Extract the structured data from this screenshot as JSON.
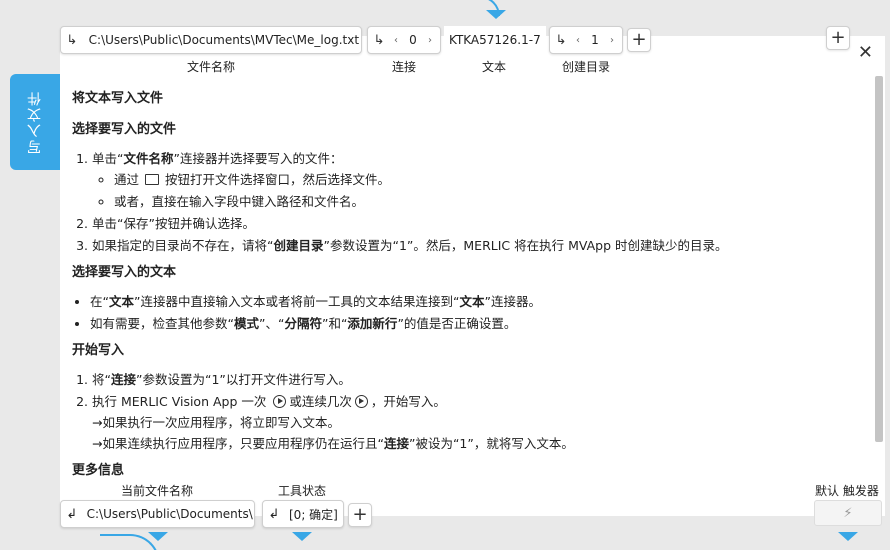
{
  "tool": {
    "side_tab_label": "写入文件"
  },
  "inputs": {
    "file_name": {
      "value": "C:\\Users\\Public\\Documents\\MVTec\\Me_log.txt",
      "label": "文件名称"
    },
    "connect": {
      "value": "0",
      "label": "连接"
    },
    "text": {
      "value": "KTKA57126.1-7",
      "label": "文本"
    },
    "create_dir": {
      "value": "1",
      "label": "创建目录"
    }
  },
  "help": {
    "title": "将文本写入文件",
    "sec1_title": "选择要写入的文件",
    "sec1_item1_pre": "单击“",
    "sec1_item1_bold": "文件名称",
    "sec1_item1_post": "”连接器并选择要写入的文件：",
    "sec1_sub1_pre": "通过",
    "sec1_sub1_post": "按钮打开文件选择窗口，然后选择文件。",
    "sec1_sub2": "或者，直接在输入字段中键入路径和文件名。",
    "sec1_item2": "单击“保存”按钮并确认选择。",
    "sec1_item3_pre": "如果指定的目录尚不存在，请将“",
    "sec1_item3_bold": "创建目录",
    "sec1_item3_post": "”参数设置为“1”。然后，MERLIC 将在执行 MVApp 时创建缺少的目录。",
    "sec2_title": "选择要写入的文本",
    "sec2_item1_pre": "在“",
    "sec2_item1_bold1": "文本",
    "sec2_item1_mid": "”连接器中直接输入文本或者将前一工具的文本结果连接到“",
    "sec2_item1_bold2": "文本",
    "sec2_item1_post": "”连接器。",
    "sec2_item2_pre": "如有需要，检查其他参数“",
    "sec2_item2_b1": "模式",
    "sec2_item2_m1": "”、“",
    "sec2_item2_b2": "分隔符",
    "sec2_item2_m2": "”和“",
    "sec2_item2_b3": "添加新行",
    "sec2_item2_post": "”的值是否正确设置。",
    "sec3_title": "开始写入",
    "sec3_item1_pre": "将“",
    "sec3_item1_bold": "连接",
    "sec3_item1_post": "”参数设置为“1”以打开文件进行写入。",
    "sec3_item2_pre": "执行 MERLIC Vision App 一次",
    "sec3_item2_mid": "或连续几次",
    "sec3_item2_post": "，开始写入。",
    "sec3_item2_line2": "→如果执行一次应用程序，将立即写入文本。",
    "sec3_item2_line3_pre": "→如果连续执行应用程序，只要应用程序仍在运行且“",
    "sec3_item2_line3_bold": "连接",
    "sec3_item2_line3_post": "”被设为“1”，就将写入文本。",
    "sec4_title": "更多信息"
  },
  "outputs": {
    "current_file": {
      "label": "当前文件名称",
      "value": "C:\\Users\\Public\\Documents\\"
    },
    "tool_state": {
      "label": "工具状态",
      "value": "[0; 确定]"
    }
  },
  "trigger": {
    "label": "默认 触发器"
  },
  "colors": {
    "accent": "#39a7e6"
  }
}
